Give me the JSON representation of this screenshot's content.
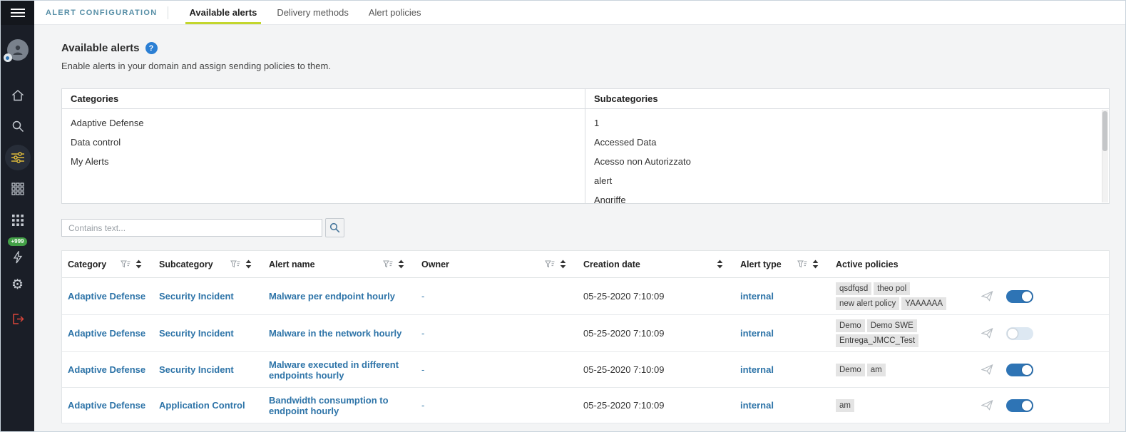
{
  "colors": {
    "accent_blue": "#2e74a8",
    "tab_underline": "#c3d62d",
    "toggle_on": "#2e74b5",
    "sidebar_bg": "#1a1e27",
    "badge_green": "#43a047",
    "section_label_teal": "#568ea6",
    "logout_red": "#d9453a",
    "active_icon_yellow": "#ddba3b",
    "tag_bg": "#e4e4e4"
  },
  "sidebar": {
    "notifications_badge": "+999"
  },
  "topbar": {
    "section_label": "ALERT CONFIGURATION",
    "tabs": [
      {
        "label": "Available alerts"
      },
      {
        "label": "Delivery methods"
      },
      {
        "label": "Alert policies"
      }
    ]
  },
  "page": {
    "title": "Available alerts",
    "subtitle": "Enable alerts in your domain and assign sending policies to them."
  },
  "panels": {
    "categories": {
      "header": "Categories",
      "items": [
        "Adaptive Defense",
        "Data control",
        "My Alerts"
      ]
    },
    "subcategories": {
      "header": "Subcategories",
      "items": [
        "1",
        "Accessed Data",
        "Acesso non Autorizzato",
        "alert",
        "Angriffe"
      ]
    }
  },
  "search": {
    "placeholder": "Contains text..."
  },
  "table": {
    "columns": [
      "Category",
      "Subcategory",
      "Alert name",
      "Owner",
      "Creation date",
      "Alert type",
      "Active policies"
    ],
    "rows": [
      {
        "category": "Adaptive Defense",
        "subcategory": "Security Incident",
        "alert_name": "Malware per endpoint hourly",
        "owner": "-",
        "creation_date": "05-25-2020 7:10:09",
        "alert_type": "internal",
        "policies": [
          "qsdfqsd",
          "theo pol",
          "new alert policy",
          "YAAAAAA"
        ],
        "enabled": true
      },
      {
        "category": "Adaptive Defense",
        "subcategory": "Security Incident",
        "alert_name": "Malware in the network hourly",
        "owner": "-",
        "creation_date": "05-25-2020 7:10:09",
        "alert_type": "internal",
        "policies": [
          "Demo",
          "Demo SWE",
          "Entrega_JMCC_Test"
        ],
        "enabled": false
      },
      {
        "category": "Adaptive Defense",
        "subcategory": "Security Incident",
        "alert_name": "Malware executed in different endpoints hourly",
        "owner": "-",
        "creation_date": "05-25-2020 7:10:09",
        "alert_type": "internal",
        "policies": [
          "Demo",
          "am"
        ],
        "enabled": true
      },
      {
        "category": "Adaptive Defense",
        "subcategory": "Application Control",
        "alert_name": "Bandwidth consumption to endpoint hourly",
        "owner": "-",
        "creation_date": "05-25-2020 7:10:09",
        "alert_type": "internal",
        "policies": [
          "am"
        ],
        "enabled": true
      }
    ]
  }
}
